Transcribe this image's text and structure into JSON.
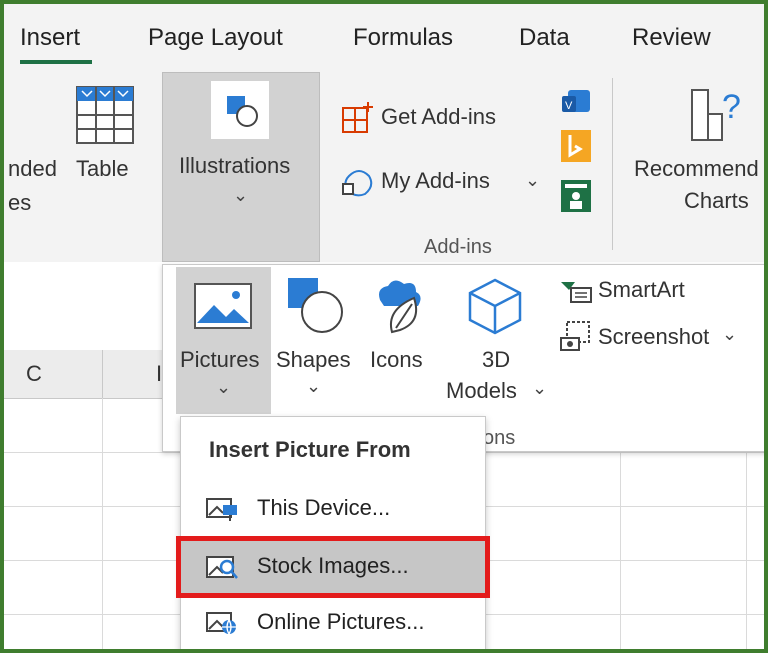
{
  "tabs": [
    {
      "label": "Insert",
      "active": true
    },
    {
      "label": "Page Layout"
    },
    {
      "label": "Formulas"
    },
    {
      "label": "Data"
    },
    {
      "label": "Review"
    }
  ],
  "ribbon": {
    "partial_left_top": "nded",
    "partial_left_bottom": "es",
    "table_label": "Table",
    "illustrations_label": "Illustrations",
    "get_addins": "Get Add-ins",
    "my_addins": "My Add-ins",
    "addins_group": "Add-ins",
    "recommended_line1": "Recommend",
    "recommended_line2": "Charts"
  },
  "sheet": {
    "column_c": "C",
    "column_partial": "I"
  },
  "illustrations_menu": {
    "pictures": "Pictures",
    "shapes": "Shapes",
    "icons": "Icons",
    "models_line1": "3D",
    "models_line2": "Models",
    "smartart": "SmartArt",
    "screenshot": "Screenshot",
    "group_partial": "ons"
  },
  "pictures_menu": {
    "title": "Insert Picture From",
    "items": [
      {
        "label": "This Device...",
        "highlighted": false
      },
      {
        "label": "Stock Images...",
        "highlighted": true
      },
      {
        "label": "Online Pictures...",
        "highlighted": false
      }
    ]
  },
  "colors": {
    "frame_border": "#3f7d2e",
    "active_tab_underline": "#1e7145",
    "highlight_box": "#e31b1b",
    "icon_blue": "#2b7cd3"
  }
}
